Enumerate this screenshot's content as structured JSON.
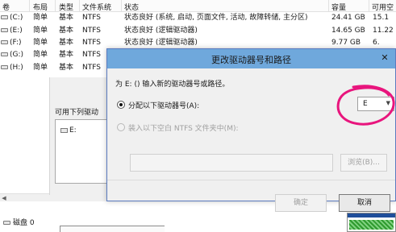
{
  "volume_table": {
    "headers": [
      "卷",
      "布局",
      "类型",
      "文件系统",
      "状态",
      "容量",
      "可用空"
    ],
    "rows": [
      {
        "vol": "(C:)",
        "layout": "简单",
        "type": "基本",
        "fs": "NTFS",
        "status": "状态良好 (系统, 启动, 页面文件, 活动, 故障转储, 主分区)",
        "capacity": "24.41 GB",
        "free": "15.1"
      },
      {
        "vol": "(E:)",
        "layout": "简单",
        "type": "基本",
        "fs": "NTFS",
        "status": "状态良好 (逻辑驱动器)",
        "capacity": "14.65 GB",
        "free": "11.22"
      },
      {
        "vol": "(F:)",
        "layout": "简单",
        "type": "基本",
        "fs": "NTFS",
        "status": "状态良好 (逻辑驱动器)",
        "capacity": "9.77 GB",
        "free": "6."
      },
      {
        "vol": "(G:)",
        "layout": "简单",
        "type": "基本",
        "fs": "NTFS",
        "status": "",
        "capacity": "",
        "free": ""
      },
      {
        "vol": "(H:)",
        "layout": "简单",
        "type": "基本",
        "fs": "NTFS",
        "status": "",
        "capacity": "",
        "free": ""
      }
    ]
  },
  "parent_dialog": {
    "label": "可用下列驱动",
    "list_item": "E:"
  },
  "disk_area": {
    "disk_label": "磁盘 0"
  },
  "dialog": {
    "title": "更改驱动器号和路径",
    "close_glyph": "✕",
    "intro": "为 E: () 输入新的驱动器号或路径。",
    "option_assign": "分配以下驱动器号(A):",
    "option_mount": "装入以下空白 NTFS 文件夹中(M):",
    "selected_letter": "E",
    "browse_label": "浏览(B)...",
    "ok_label": "确定",
    "cancel_label": "取消"
  },
  "colors": {
    "title_bar": "#6fa8dc",
    "annotation_circle": "#e8157d"
  }
}
